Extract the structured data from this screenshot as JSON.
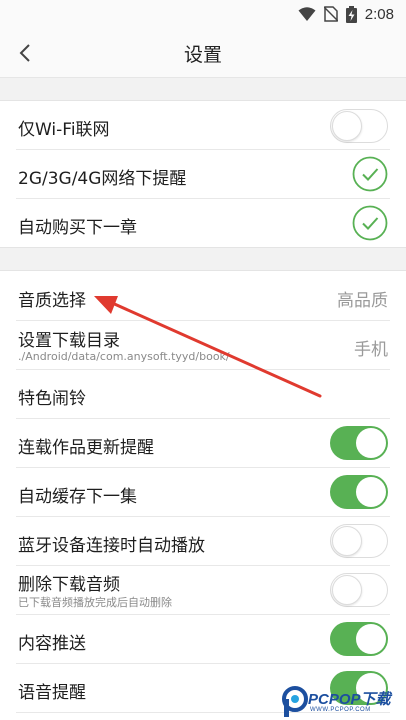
{
  "status_bar": {
    "time": "2:08",
    "icons": [
      "wifi-icon",
      "no-sim-icon",
      "battery-charging-icon"
    ]
  },
  "header": {
    "title": "设置",
    "back_icon": "chevron-left-icon"
  },
  "network_group": [
    {
      "label": "仅Wi-Fi联网",
      "control": "toggle",
      "state": "off"
    },
    {
      "label": "2G/3G/4G网络下提醒",
      "control": "check",
      "state": "on"
    },
    {
      "label": "自动购买下一章",
      "control": "check",
      "state": "on"
    }
  ],
  "playback_group": [
    {
      "label": "音质选择",
      "control": "value",
      "value": "高品质"
    },
    {
      "label": "设置下载目录",
      "sub": "./Android/data/com.anysoft.tyyd/book/",
      "control": "value",
      "value": "手机"
    },
    {
      "label": "特色闹铃",
      "control": "none"
    },
    {
      "label": "连载作品更新提醒",
      "control": "toggle",
      "state": "on"
    },
    {
      "label": "自动缓存下一集",
      "control": "toggle",
      "state": "on"
    },
    {
      "label": "蓝牙设备连接时自动播放",
      "control": "toggle",
      "state": "off"
    },
    {
      "label": "删除下载音频",
      "sub": "已下载音频播放完成后自动删除",
      "control": "toggle",
      "state": "off"
    },
    {
      "label": "内容推送",
      "control": "toggle",
      "state": "on"
    },
    {
      "label": "语音提醒",
      "control": "toggle",
      "state": "on"
    }
  ],
  "colors": {
    "accent_green": "#58b154",
    "arrow_red": "#e03a2f",
    "watermark_blue": "#1c4f9f"
  },
  "watermark": {
    "text": "PCPOP下载",
    "sub": "WWW.PCPOP.COM"
  }
}
